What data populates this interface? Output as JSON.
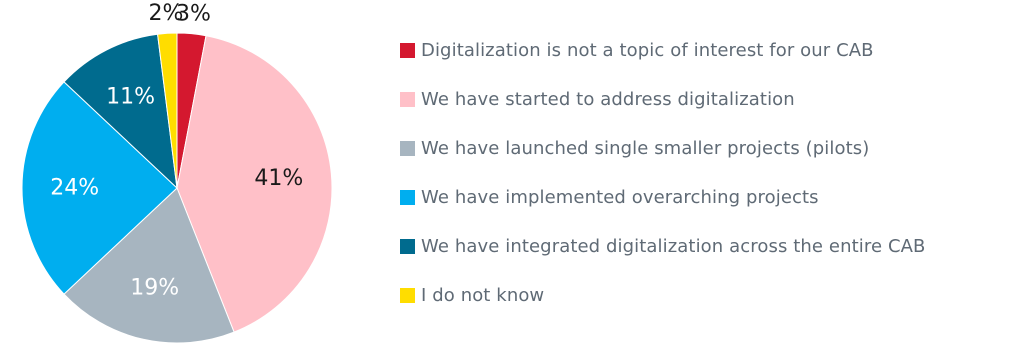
{
  "chart_data": {
    "type": "pie",
    "slices": [
      {
        "label": "Digitalization is not a topic of interest for our CAB",
        "value": 3,
        "display": "3%",
        "color": "#d4182f",
        "label_color": "#1a1a1a",
        "label_placement": "outside"
      },
      {
        "label": "We have started to address digitalization",
        "value": 41,
        "display": "41%",
        "color": "#ffc0c8",
        "label_color": "#1a1a1a",
        "label_placement": "inside"
      },
      {
        "label": "We have launched single smaller projects (pilots)",
        "value": 19,
        "display": "19%",
        "color": "#a7b5c0",
        "label_color": "#ffffff",
        "label_placement": "inside"
      },
      {
        "label": "We have implemented overarching projects",
        "value": 24,
        "display": "24%",
        "color": "#00aeef",
        "label_color": "#ffffff",
        "label_placement": "inside"
      },
      {
        "label": "We have integrated digitalization across the entire CAB",
        "value": 11,
        "display": "11%",
        "color": "#006b8e",
        "label_color": "#ffffff",
        "label_placement": "inside"
      },
      {
        "label": "I do not know",
        "value": 2,
        "display": "2%",
        "color": "#ffdd00",
        "label_color": "#1a1a1a",
        "label_placement": "outside"
      }
    ],
    "start_position": "top",
    "direction": "clockwise",
    "legend_position": "right"
  }
}
